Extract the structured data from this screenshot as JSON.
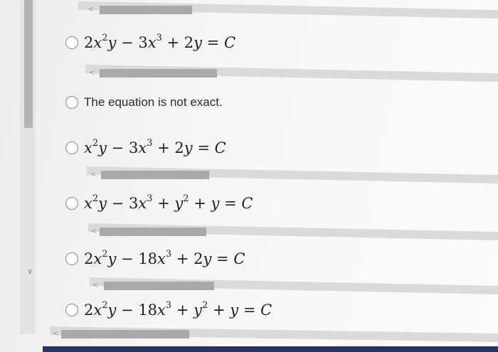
{
  "scroll": {
    "left_arrow": "<",
    "down_arrow": "∨"
  },
  "options": [
    {
      "type": "math",
      "lead": "2",
      "latex": "2x^2y - 3x^3 + 2y = C"
    },
    {
      "type": "text",
      "text": "The equation is not exact."
    },
    {
      "type": "math",
      "latex": "x^2y - 3x^3 + 2y = C"
    },
    {
      "type": "math",
      "latex": "x^2y - 3x^3 + y^2 + y = C"
    },
    {
      "type": "math",
      "latex": "2x^2y - 18x^3 + 2y = C"
    },
    {
      "type": "math",
      "latex": "2x^2y - 18x^3 + y^2 + y = C"
    }
  ],
  "colors": {
    "thumb": "#a9a9a9",
    "track": "#dadada",
    "taskbar": "#23365c"
  }
}
